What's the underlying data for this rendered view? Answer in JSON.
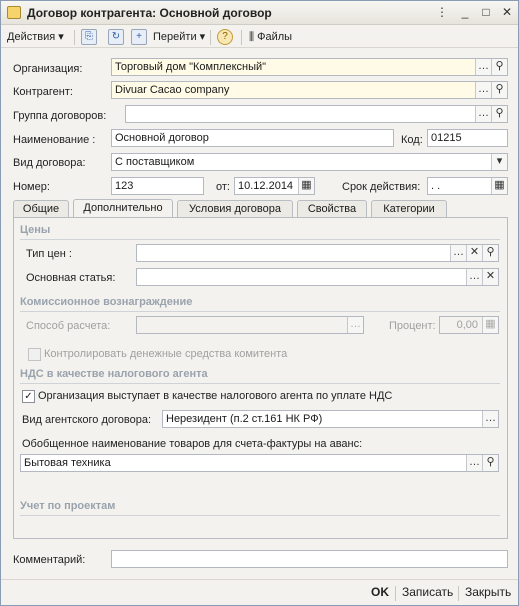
{
  "window": {
    "title": "Договор контрагента: Основной договор"
  },
  "toolbar": {
    "actions": "Действия",
    "goto": "Перейти",
    "files": "Файлы"
  },
  "form": {
    "organization_label": "Организация:",
    "organization_value": "Торговый дом \"Комплексный\"",
    "counterparty_label": "Контрагент:",
    "counterparty_value": "Divuar Cacao company",
    "group_label": "Группа договоров:",
    "group_value": "",
    "name_label": "Наименование :",
    "name_value": "Основной договор",
    "code_label": "Код:",
    "code_value": "01215",
    "type_label": "Вид договора:",
    "type_value": "С поставщиком",
    "number_label": "Номер:",
    "number_value": "123",
    "from_label": "от:",
    "from_value": "10.12.2014",
    "term_label": "Срок действия:",
    "term_value": "  .  .",
    "comment_label": "Комментарий:",
    "comment_value": ""
  },
  "tabs": [
    "Общие",
    "Дополнительно",
    "Условия договора",
    "Свойства",
    "Категории"
  ],
  "panel": {
    "prices_section": "Цены",
    "price_type_label": "Тип цен :",
    "price_type_value": "",
    "main_article_label": "Основная статья:",
    "main_article_value": "",
    "commission_section": "Комиссионное вознаграждение",
    "calc_method_label": "Способ расчета:",
    "calc_method_value": "",
    "percent_label": "Процент:",
    "percent_value": "0,00",
    "control_funds_label": "Контролировать денежные средства комитента",
    "vat_section": "НДС в качестве налогового агента",
    "org_acts_agent_label": "Организация выступает в качестве налогового агента по уплате НДС",
    "agent_contract_label": "Вид агентского договора:",
    "agent_contract_value": "Нерезидент (п.2 ст.161 НК РФ)",
    "generalized_name_label": "Обобщенное наименование товаров для счета-фактуры на аванс:",
    "generalized_name_value": "Бытовая техника",
    "projects_section": "Учет по проектам"
  },
  "bottom": {
    "ok": "OK",
    "save": "Записать",
    "close": "Закрыть"
  }
}
